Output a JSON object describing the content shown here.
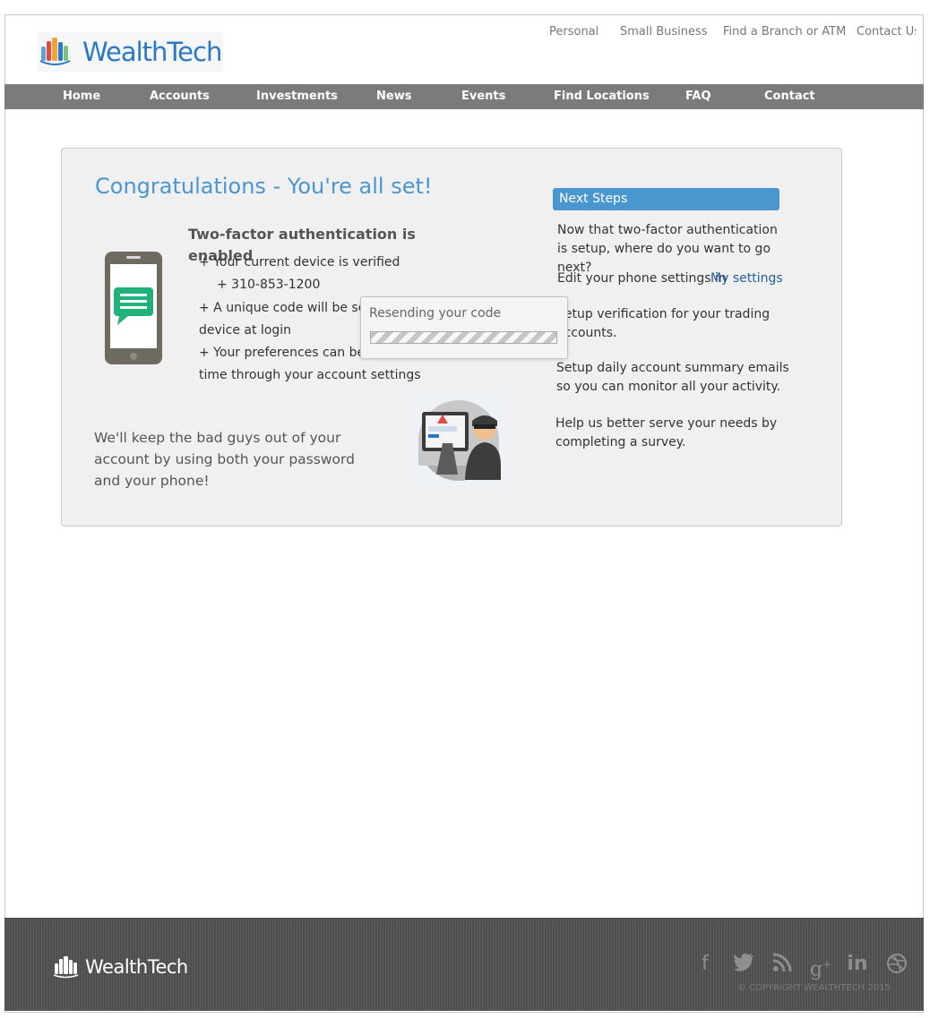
{
  "brand": {
    "logo_text": "WealthTech",
    "footer_logo_text": "WealthTech"
  },
  "top_links": [
    "Personal",
    "Small Business",
    "Find a Branch or ATM",
    "Contact Us"
  ],
  "nav": [
    "Home",
    "Accounts",
    "Investments",
    "News",
    "Events",
    "Find Locations",
    "FAQ",
    "Contact"
  ],
  "main": {
    "heading": "Congratulations - You're all set!",
    "subheading": "Two-factor authentication is enabled",
    "bullets": {
      "device_verified": "+ Your current device is verified",
      "phone_number": "+ 310-853-1200",
      "unique_code_1": "+ A unique code will be se",
      "unique_code_2": "device at login",
      "preferences_1": "+ Your preferences can be",
      "preferences_2": "time through your account settings"
    },
    "tagline": "We'll keep the bad guys out of your account by using both your password and your phone!"
  },
  "next_steps": {
    "title": "Next Steps",
    "intro": "Now that two-factor authentication is setup, where do you want to go next?",
    "edit_phone_text": "Edit your phone settings in",
    "my_settings_link": "My settings",
    "trading_verification": "Setup verification for your trading accounts.",
    "daily_summary": "Setup daily account summary emails so you can monitor all your activity.",
    "survey": "Help us better serve your needs by completing a survey."
  },
  "modal": {
    "message": "Resending your code",
    "progress_percent": 100
  },
  "footer": {
    "social_icons": [
      "facebook-icon",
      "twitter-icon",
      "rss-icon",
      "google-plus-icon",
      "linkedin-icon",
      "dribbble-icon"
    ],
    "copyright": "© COPYRIGHT WEALTHTECH 2015"
  },
  "colors": {
    "accent": "#4a97cf",
    "nav_bg": "#7b7b7b",
    "panel_bg": "#f0f0f0",
    "footer_bg": "#555555",
    "phone_screen": "#21b27a"
  }
}
